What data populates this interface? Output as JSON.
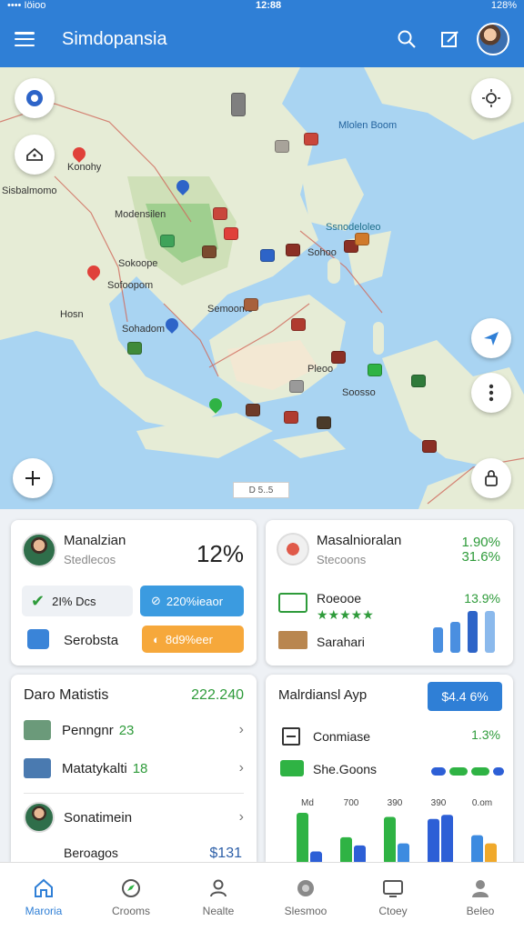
{
  "status_bar": {
    "left": "•••• Iöioo",
    "time": "12:88",
    "right": "128%"
  },
  "app_bar": {
    "title": "Simdopansia"
  },
  "map": {
    "labels": [
      "Mlolen Boom",
      "Konohy",
      "Sisbalmomo",
      "Modensilen",
      "Ssnodeloleo",
      "Sokoope",
      "Sofoopom",
      "Semoomo",
      "Hosn",
      "Sohadom",
      "Sohoo",
      "Pleoo",
      "Soosso"
    ],
    "scale_text": "D 5..5"
  },
  "card1": {
    "name": "Manalzian",
    "sub": "Stedlecos",
    "percent": "12%",
    "chip1": "2I% Dcs",
    "chip2": "220%ieaor",
    "row_label": "Serobsta",
    "chip3": "8d9%eer"
  },
  "card2": {
    "name": "Masalnioralan",
    "sub": "Stecoons",
    "val1": "1.90%",
    "val2": "31.6%",
    "item1": "Roeooe",
    "stars": "★★★★★",
    "val3": "13.9%",
    "item2": "Sarahari"
  },
  "card3": {
    "title": "Daro Matistis",
    "value": "222.240",
    "rows": [
      {
        "label": "Penngnr",
        "value": "23"
      },
      {
        "label": "Matatykalti",
        "value": "18"
      }
    ],
    "person": "Sonatimein",
    "footer_label": "Beroagos",
    "footer_value": "$131"
  },
  "card4": {
    "title": "Malrdiansl Ayp",
    "badge": "$4.4 6%",
    "row1": "Conmiase",
    "row1_value": "1.3%",
    "row2": "She.Goons"
  },
  "chart_data": {
    "type": "bar",
    "categories": [
      "Md",
      "700",
      "390",
      "390",
      "0.om"
    ],
    "series": [
      {
        "values": [
          50,
          26,
          46,
          44,
          28
        ]
      },
      {
        "values": [
          12,
          18,
          20,
          48,
          20
        ]
      }
    ],
    "colors": [
      "#2fb344",
      "#2d5fd6",
      "#3d8be0",
      "#f0a92b"
    ]
  },
  "bottom_nav": [
    {
      "label": "Maroria",
      "icon": "home-icon"
    },
    {
      "label": "Crooms",
      "icon": "compass-icon"
    },
    {
      "label": "Nealte",
      "icon": "person-icon"
    },
    {
      "label": "Slesmoo",
      "icon": "globe-icon"
    },
    {
      "label": "Ctoey",
      "icon": "tv-icon"
    },
    {
      "label": "Beleo",
      "icon": "profile-icon"
    }
  ],
  "colors": {
    "primary": "#2f7fd6",
    "green": "#2e9b3a",
    "orange": "#f6a83b"
  }
}
